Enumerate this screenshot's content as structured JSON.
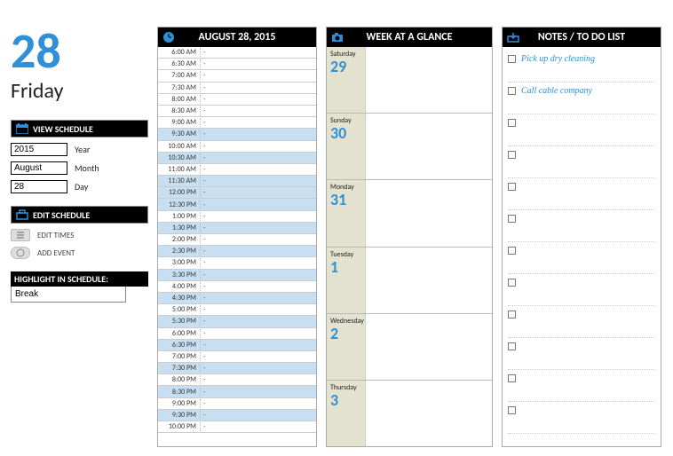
{
  "date": {
    "big_number": "28",
    "weekday": "Friday"
  },
  "sections": {
    "view_schedule": "VIEW SCHEDULE",
    "edit_schedule": "EDIT SCHEDULE",
    "highlight": "HIGHLIGHT IN SCHEDULE:"
  },
  "form": {
    "year_value": "2015",
    "year_label": "Year",
    "month_value": "August",
    "month_label": "Month",
    "day_value": "28",
    "day_label": "Day"
  },
  "buttons": {
    "edit_times": "EDIT TIMES",
    "add_event": "ADD EVENT"
  },
  "highlight_value": "Break",
  "schedule": {
    "header": "AUGUST 28, 2015",
    "times": [
      "6:00 AM",
      "6:30 AM",
      "7:00 AM",
      "7:30 AM",
      "8:00 AM",
      "8:30 AM",
      "9:00 AM",
      "9:30 AM",
      "10:00 AM",
      "10:30 AM",
      "11:00 AM",
      "11:30 AM",
      "12:00 PM",
      "12:30 PM",
      "1:00 PM",
      "1:30 PM",
      "2:00 PM",
      "2:30 PM",
      "3:00 PM",
      "3:30 PM",
      "4:00 PM",
      "4:30 PM",
      "5:00 PM",
      "5:30 PM",
      "6:00 PM",
      "6:30 PM",
      "7:00 PM",
      "7:30 PM",
      "8:00 PM",
      "8:30 PM",
      "9:00 PM",
      "9:30 PM",
      "10:00 PM"
    ]
  },
  "week": {
    "header": "WEEK AT A GLANCE",
    "days": [
      {
        "name": "Saturday",
        "num": "29"
      },
      {
        "name": "Sunday",
        "num": "30"
      },
      {
        "name": "Monday",
        "num": "31"
      },
      {
        "name": "Tuesday",
        "num": "1"
      },
      {
        "name": "Wednesday",
        "num": "2"
      },
      {
        "name": "Thursday",
        "num": "3"
      }
    ]
  },
  "notes": {
    "header": "NOTES / TO DO LIST",
    "items": [
      "Pick up dry cleaning",
      "Call cable company",
      "",
      "",
      "",
      "",
      "",
      "",
      "",
      "",
      "",
      ""
    ]
  }
}
